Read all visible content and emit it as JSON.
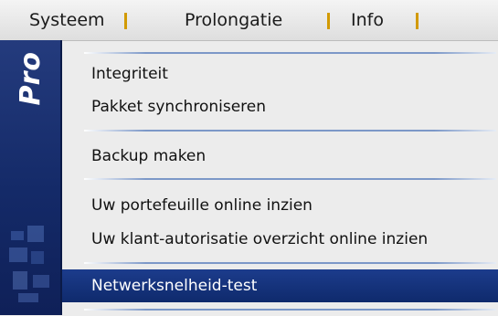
{
  "menubar": {
    "items": [
      {
        "label": "Systeem"
      },
      {
        "label": "Prolongatie"
      },
      {
        "label": "Info"
      }
    ]
  },
  "sidebar": {
    "brand_text": "Pro"
  },
  "dropdown": {
    "items": [
      {
        "label": "Integriteit"
      },
      {
        "label": "Pakket synchroniseren"
      },
      {
        "label": "Backup maken"
      },
      {
        "label": "Uw portefeuille online inzien"
      },
      {
        "label": "Uw klant-autorisatie overzicht online inzien"
      },
      {
        "label": "Netwerksnelheid-test",
        "selected": true
      }
    ]
  },
  "colors": {
    "sidebar": "#142a68",
    "selection": "#1c3c8c",
    "separator": "#d29a00",
    "menu_background": "#ececec"
  }
}
